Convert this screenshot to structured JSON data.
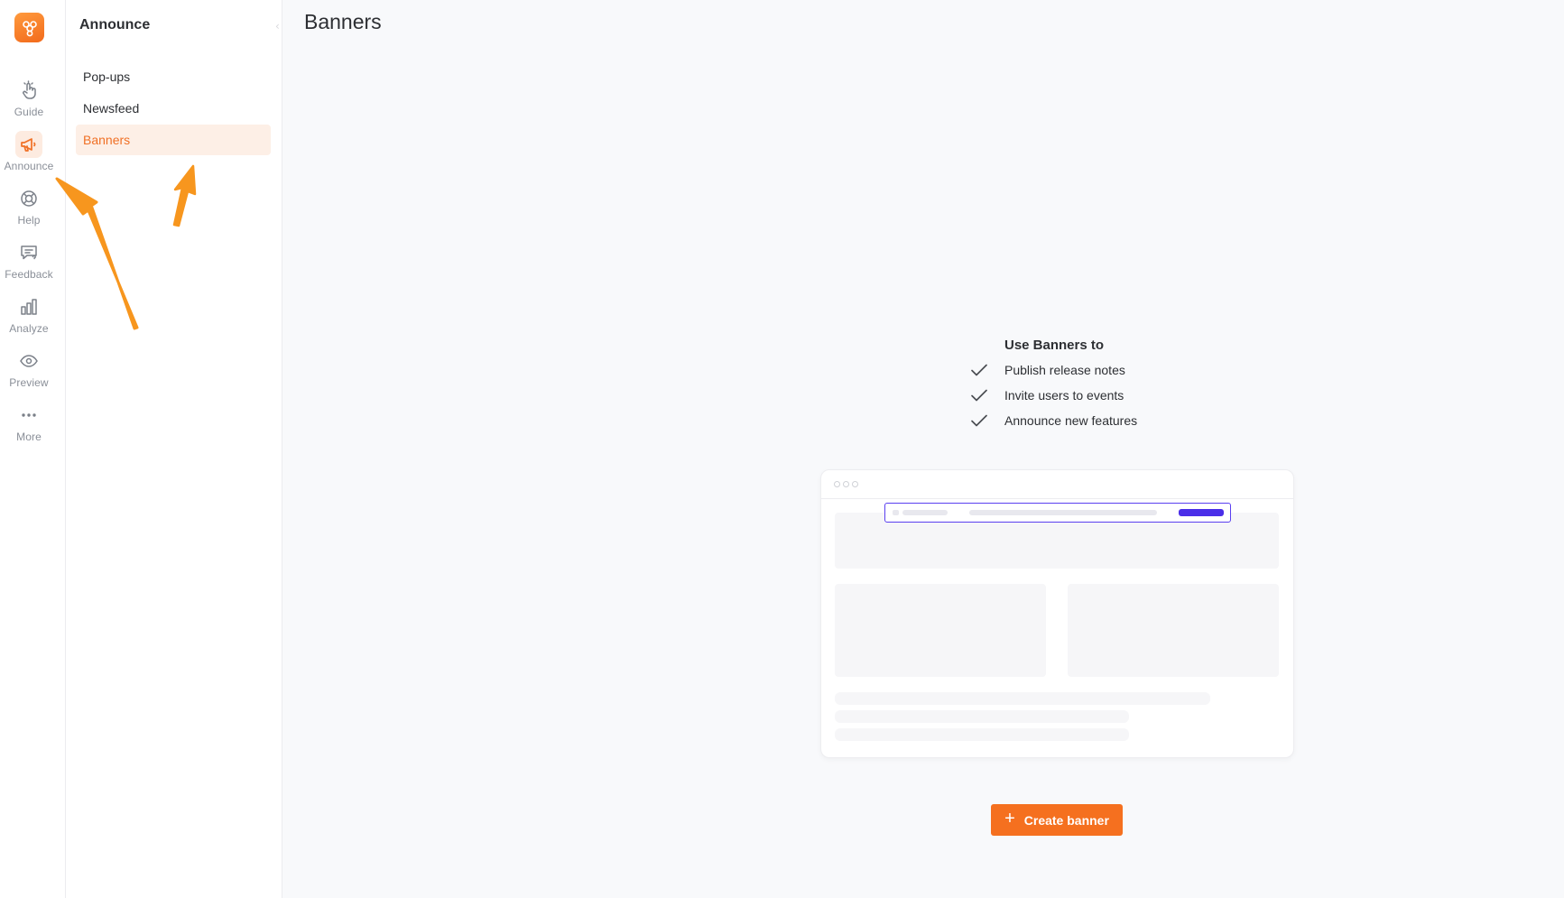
{
  "rail": {
    "items": [
      {
        "label": "Guide",
        "icon": "hand-pointer-icon"
      },
      {
        "label": "Announce",
        "icon": "megaphone-icon"
      },
      {
        "label": "Help",
        "icon": "lifebuoy-icon"
      },
      {
        "label": "Feedback",
        "icon": "chat-question-icon"
      },
      {
        "label": "Analyze",
        "icon": "bar-chart-icon"
      },
      {
        "label": "Preview",
        "icon": "eye-icon"
      },
      {
        "label": "More",
        "icon": "more-dots-icon"
      }
    ],
    "active": "Announce"
  },
  "sidebar": {
    "title": "Announce",
    "items": [
      {
        "label": "Pop-ups"
      },
      {
        "label": "Newsfeed"
      },
      {
        "label": "Banners"
      }
    ],
    "active": "Banners"
  },
  "main": {
    "title": "Banners",
    "uses": {
      "title": "Use Banners to",
      "items": [
        "Publish release notes",
        "Invite users to events",
        "Announce new features"
      ]
    },
    "create_label": "Create banner"
  },
  "colors": {
    "accent": "#f5701f",
    "active_bg": "#fdefe6",
    "banner_outline": "#5a3ff0",
    "annotation_arrow": "#f7961e"
  }
}
